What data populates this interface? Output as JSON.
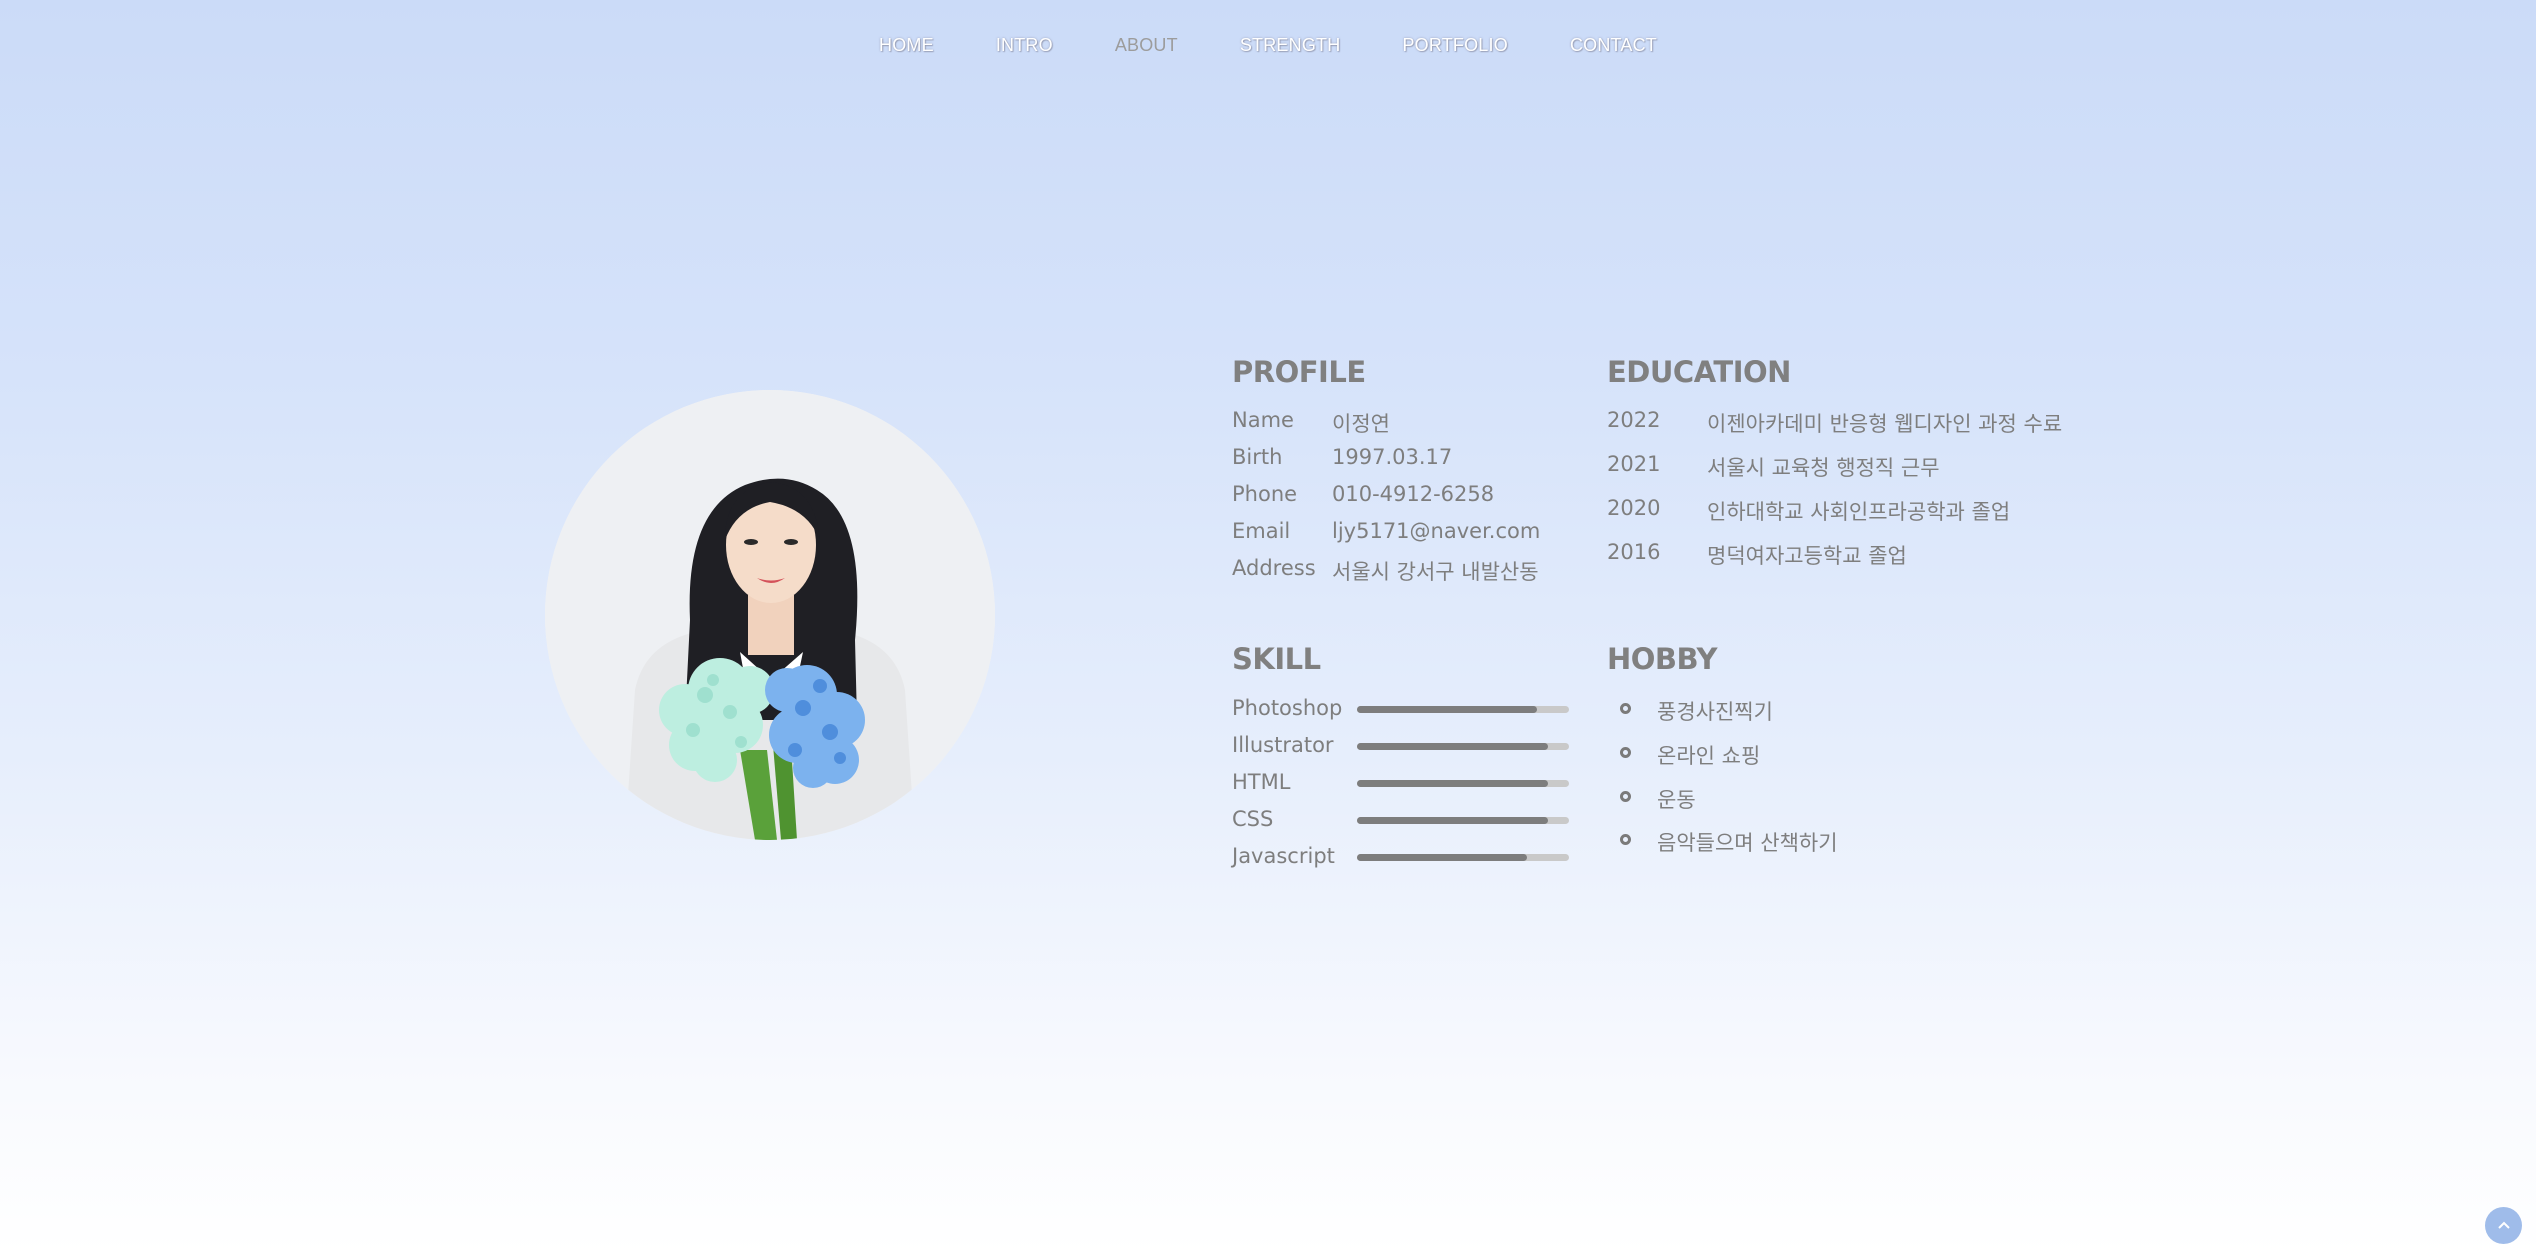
{
  "nav": {
    "items": [
      {
        "label": "HOME"
      },
      {
        "label": "INTRO"
      },
      {
        "label": "ABOUT"
      },
      {
        "label": "STRENGTH"
      },
      {
        "label": "PORTFOLIO"
      },
      {
        "label": "CONTACT"
      }
    ],
    "active": "ABOUT"
  },
  "profile": {
    "title": "PROFILE",
    "rows": [
      {
        "label": "Name",
        "value": "이정연"
      },
      {
        "label": "Birth",
        "value": "1997.03.17"
      },
      {
        "label": "Phone",
        "value": "010-4912-6258"
      },
      {
        "label": "Email",
        "value": "ljy5171@naver.com"
      },
      {
        "label": "Address",
        "value": "서울시 강서구 내발산동"
      }
    ]
  },
  "education": {
    "title": "EDUCATION",
    "rows": [
      {
        "year": "2022",
        "desc": "이젠아카데미 반응형 웹디자인 과정 수료"
      },
      {
        "year": "2021",
        "desc": "서울시 교육청 행정직 근무"
      },
      {
        "year": "2020",
        "desc": "인하대학교 사회인프라공학과 졸업"
      },
      {
        "year": "2016",
        "desc": "명덕여자고등학교 졸업"
      }
    ]
  },
  "skill": {
    "title": "SKILL",
    "items": [
      {
        "label": "Photoshop",
        "level": 0.85
      },
      {
        "label": "Illustrator",
        "level": 0.9
      },
      {
        "label": "HTML",
        "level": 0.9
      },
      {
        "label": "CSS",
        "level": 0.9
      },
      {
        "label": "Javascript",
        "level": 0.8
      }
    ]
  },
  "hobby": {
    "title": "HOBBY",
    "items": [
      {
        "label": "풍경사진찍기"
      },
      {
        "label": "온라인 쇼핑"
      },
      {
        "label": "운동"
      },
      {
        "label": "음악들으며 산책하기"
      }
    ]
  },
  "photo": {
    "icon": "profile-photo"
  },
  "scroll_top": {
    "icon": "chevron-up-icon"
  },
  "colors": {
    "accent": "#9fbcea",
    "text": "#7a7a7a",
    "bar_fill": "#7d7d7d",
    "bar_track": "#c9c9c9"
  }
}
